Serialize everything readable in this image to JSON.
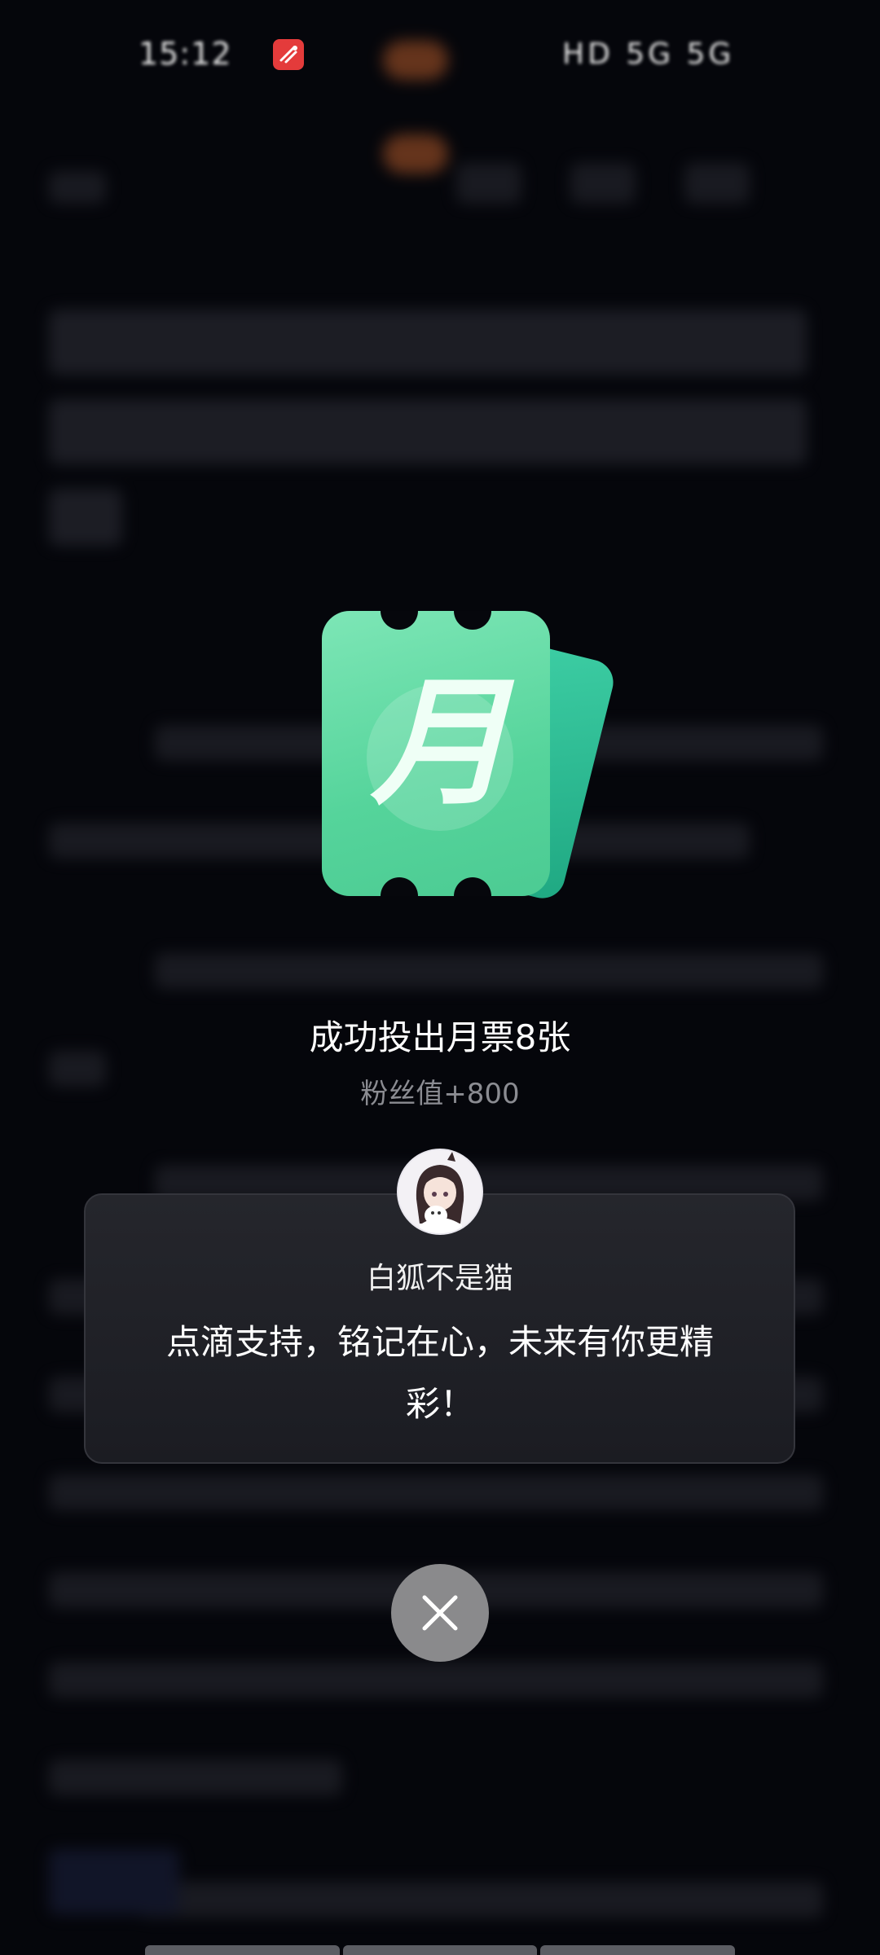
{
  "status_bar": {
    "time": "15:12",
    "right_indicators": "HD 5G 5G"
  },
  "reward": {
    "ticket_glyph": "月",
    "success_title": "成功投出月票8张",
    "fan_value": "粉丝值+800"
  },
  "author": {
    "name": "白狐不是猫",
    "message": "点滴支持，铭记在心，未来有你更精彩！"
  },
  "colors": {
    "ticket_green": "#55d49b",
    "ticket_back_green": "#2fbf94",
    "close_button": "#8a8a8c",
    "card_bg": "#1f2026",
    "subtext_gray": "#8b8c92"
  },
  "icons": {
    "close": "close-icon",
    "app": "app-logo-icon"
  }
}
